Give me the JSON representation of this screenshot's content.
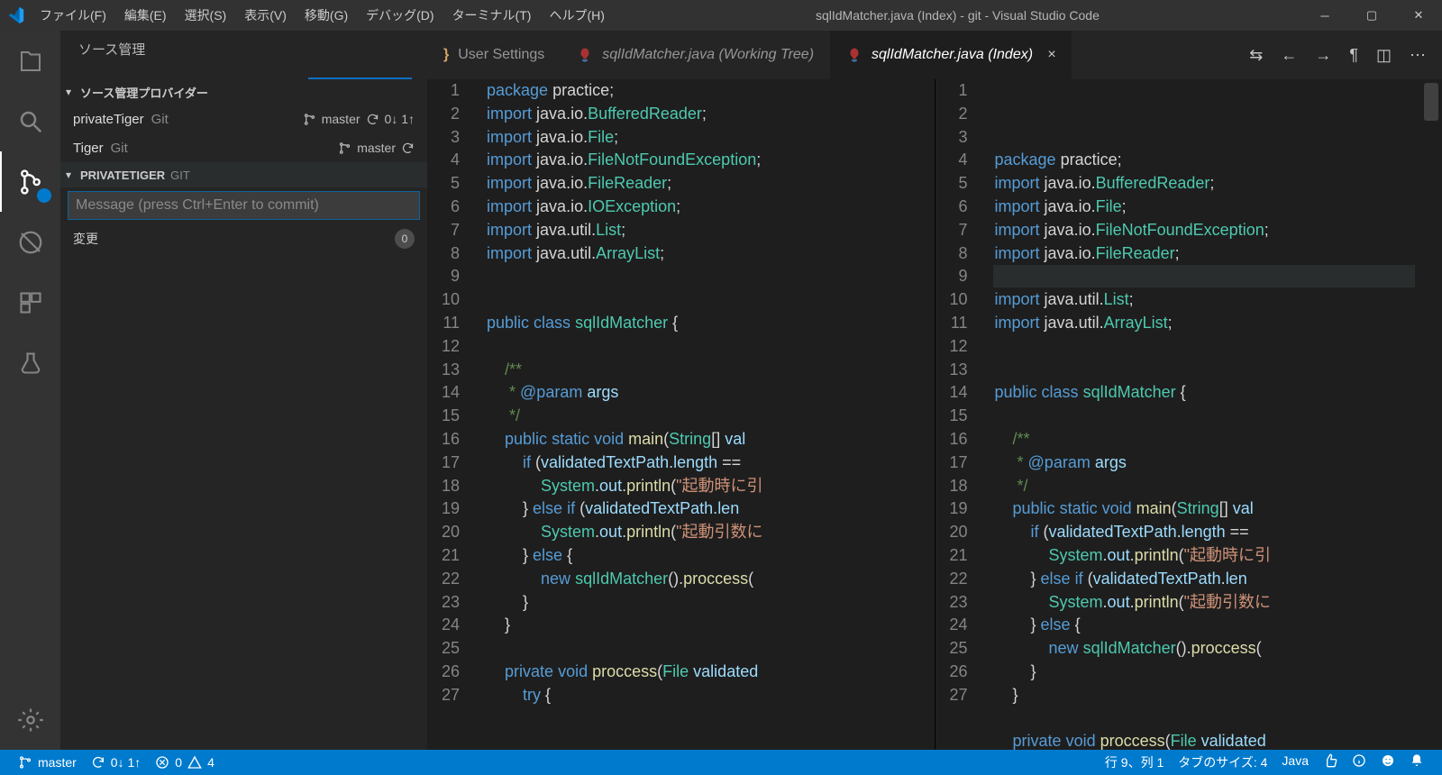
{
  "window_title": "sqlIdMatcher.java (Index) - git - Visual Studio Code",
  "menu": [
    "ファイル(F)",
    "編集(E)",
    "選択(S)",
    "表示(V)",
    "移動(G)",
    "デバッグ(D)",
    "ターミナル(T)",
    "ヘルプ(H)"
  ],
  "sidebar": {
    "title": "ソース管理",
    "providers_label": "ソース管理プロバイダー",
    "repos": [
      {
        "name": "privateTiger",
        "kind": "Git",
        "branch": "master",
        "sync": "0↓ 1↑"
      },
      {
        "name": "Tiger",
        "kind": "Git",
        "branch": "master",
        "sync": ""
      }
    ],
    "repo_header": {
      "name": "PRIVATETIGER",
      "kind": "GIT"
    },
    "commit_placeholder": "Message (press Ctrl+Enter to commit)",
    "changes_label": "変更",
    "changes_count": "0"
  },
  "tabs": [
    {
      "label": "User Settings",
      "icon": "braces-icon",
      "active": false,
      "italic": false
    },
    {
      "label": "sqlIdMatcher.java (Working Tree)",
      "icon": "java-icon",
      "active": false,
      "italic": true
    },
    {
      "label": "sqlIdMatcher.java (Index)",
      "icon": "java-icon",
      "active": true,
      "italic": true
    }
  ],
  "code_lines": [
    {
      "n": "1",
      "h": "<span class='kw'>package</span> <span class='pkg'>practice</span>;"
    },
    {
      "n": "2",
      "h": "<span class='kw'>import</span> <span class='pkg'>java</span>.<span class='pkg'>io</span>.<span class='type'>BufferedReader</span>;"
    },
    {
      "n": "3",
      "h": "<span class='kw'>import</span> <span class='pkg'>java</span>.<span class='pkg'>io</span>.<span class='type'>File</span>;"
    },
    {
      "n": "4",
      "h": "<span class='kw'>import</span> <span class='pkg'>java</span>.<span class='pkg'>io</span>.<span class='type'>FileNotFoundException</span>;"
    },
    {
      "n": "5",
      "h": "<span class='kw'>import</span> <span class='pkg'>java</span>.<span class='pkg'>io</span>.<span class='type'>FileReader</span>;"
    },
    {
      "n": "6",
      "h": "<span class='kw'>import</span> <span class='pkg'>java</span>.<span class='pkg'>io</span>.<span class='type'>IOException</span>;"
    },
    {
      "n": "7",
      "h": "<span class='kw'>import</span> <span class='pkg'>java</span>.<span class='pkg'>util</span>.<span class='type'>List</span>;"
    },
    {
      "n": "8",
      "h": "<span class='kw'>import</span> <span class='pkg'>java</span>.<span class='pkg'>util</span>.<span class='type'>ArrayList</span>;"
    },
    {
      "n": "9",
      "h": ""
    },
    {
      "n": "10",
      "h": ""
    },
    {
      "n": "11",
      "h": "<span class='kw'>public</span> <span class='kw'>class</span> <span class='type'>sqlIdMatcher</span> <span class='pn'>{</span>"
    },
    {
      "n": "12",
      "h": ""
    },
    {
      "n": "13",
      "h": "    <span class='doc'>/**</span>"
    },
    {
      "n": "14",
      "h": "    <span class='doc'> * </span><span class='doctag'>@param</span> <span class='var'>args</span>"
    },
    {
      "n": "15",
      "h": "    <span class='doc'> */</span>"
    },
    {
      "n": "16",
      "h": "    <span class='kw'>public</span> <span class='kw'>static</span> <span class='kw'>void</span> <span class='fn'>main</span>(<span class='type'>String</span>[] <span class='var'>val</span>"
    },
    {
      "n": "17",
      "h": "        <span class='kw'>if</span> (<span class='var'>validatedTextPath</span>.<span class='var'>length</span> == "
    },
    {
      "n": "18",
      "h": "            <span class='type'>System</span>.<span class='var'>out</span>.<span class='fn'>println</span>(<span class='str'>\"起動時に引</span>"
    },
    {
      "n": "19",
      "h": "        } <span class='kw'>else</span> <span class='kw'>if</span> (<span class='var'>validatedTextPath</span>.<span class='var'>len</span>"
    },
    {
      "n": "20",
      "h": "            <span class='type'>System</span>.<span class='var'>out</span>.<span class='fn'>println</span>(<span class='str'>\"起動引数に</span>"
    },
    {
      "n": "21",
      "h": "        } <span class='kw'>else</span> {"
    },
    {
      "n": "22",
      "h": "            <span class='kw'>new</span> <span class='type'>sqlIdMatcher</span>().<span class='fn'>proccess</span>("
    },
    {
      "n": "23",
      "h": "        }"
    },
    {
      "n": "24",
      "h": "    }"
    },
    {
      "n": "25",
      "h": ""
    },
    {
      "n": "26",
      "h": "    <span class='kw'>private</span> <span class='kw'>void</span> <span class='fn'>proccess</span>(<span class='type'>File</span> <span class='var'>validated</span>"
    },
    {
      "n": "27",
      "h": "        <span class='kw'>try</span> {"
    }
  ],
  "statusbar": {
    "branch": "master",
    "sync": "0↓ 1↑",
    "errors": "0",
    "warnings": "4",
    "ln_col": "行 9、列 1",
    "tabsize": "タブのサイズ: 4",
    "language": "Java"
  }
}
